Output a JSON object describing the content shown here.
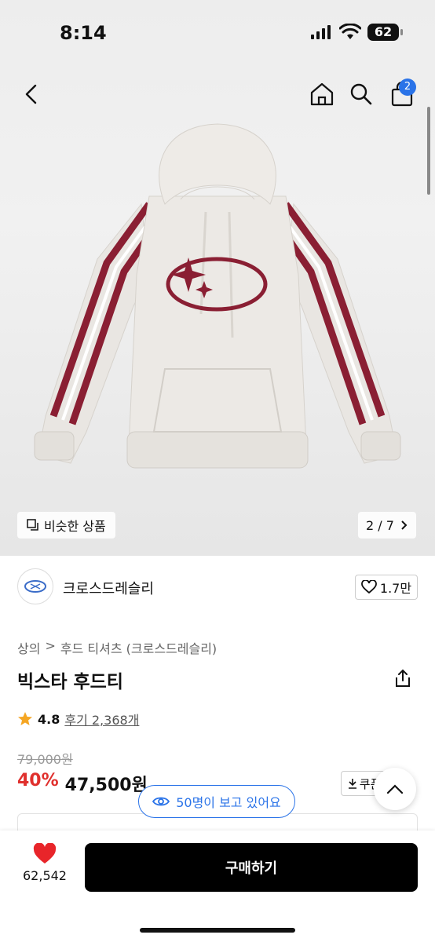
{
  "status": {
    "time": "8:14",
    "battery": "62"
  },
  "header": {
    "cart_count": "2"
  },
  "gallery": {
    "similar_label": "비슷한 상품",
    "counter": "2 / 7"
  },
  "brand": {
    "name": "크로스드레슬리",
    "likes": "1.7만"
  },
  "breadcrumb": {
    "category": "상의",
    "separator": ">",
    "subcategory": "후드 티셔츠 (크로스드레슬리)"
  },
  "product": {
    "title": "빅스타 후드티",
    "rating": "4.8",
    "reviews": "후기 2,368개",
    "original_price": "79,000원",
    "discount": "40%",
    "sale_price": "47,500원",
    "coupon_label": "쿠폰"
  },
  "viewers_label": "50명이 보고 있어요",
  "bottom": {
    "heart_count": "62,542",
    "buy_label": "구매하기"
  },
  "colors": {
    "accent": "#2a73e8",
    "discount": "#e0302d",
    "heart": "#e8252a",
    "star": "#f5a623",
    "stripe": "#8a1f33"
  },
  "icons": [
    "back-icon",
    "home-icon",
    "search-icon",
    "cart-icon",
    "similar-icon",
    "chevron-right-icon",
    "heart-outline-icon",
    "share-icon",
    "star-icon",
    "download-icon",
    "chevron-up-icon",
    "eye-icon",
    "heart-filled-icon"
  ]
}
